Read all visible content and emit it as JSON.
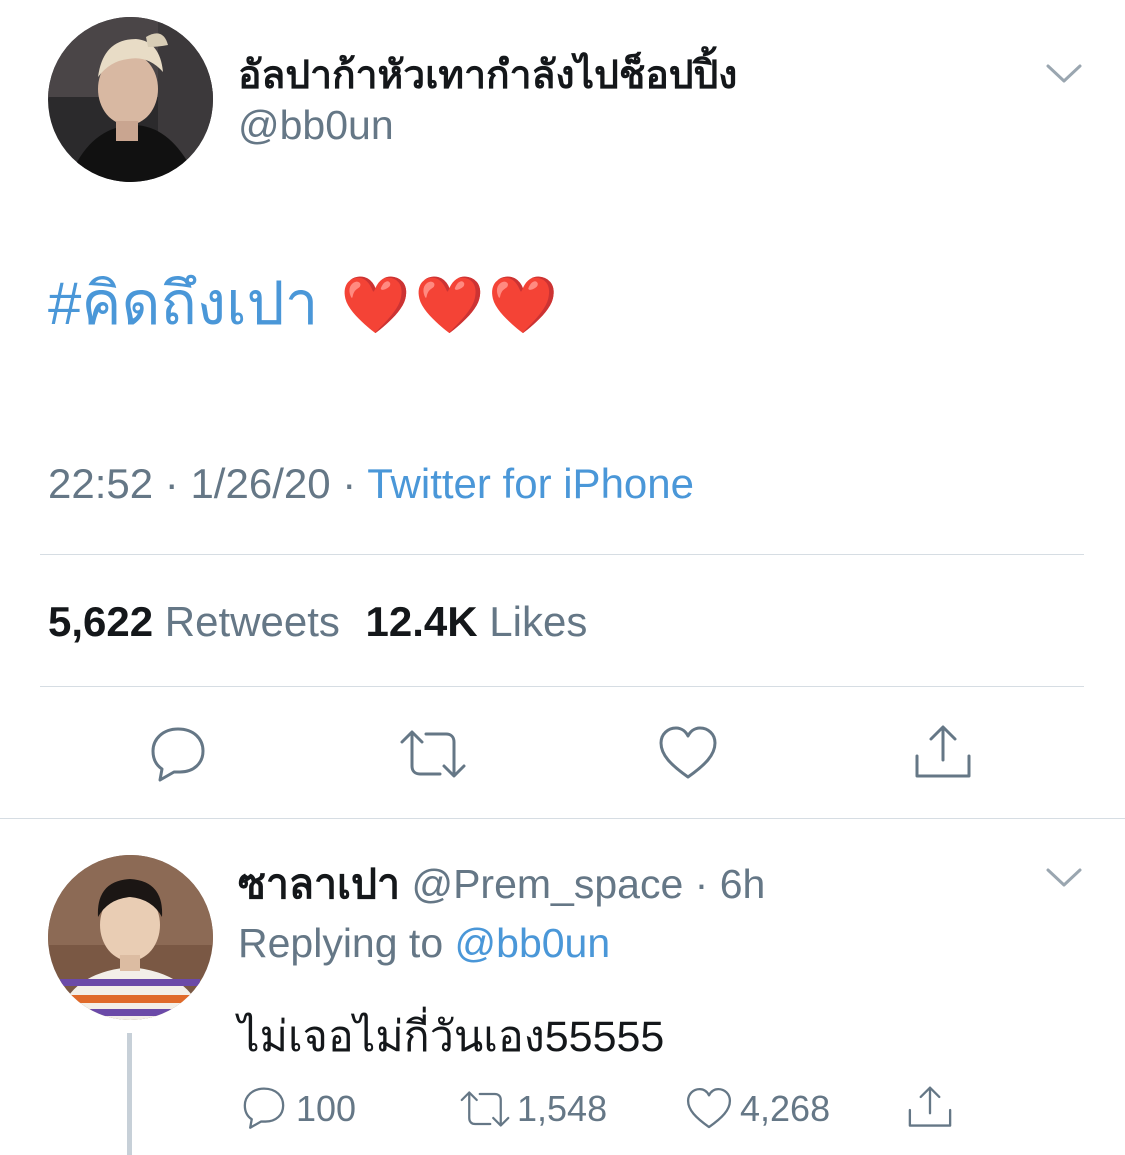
{
  "tweet": {
    "display_name": "อัลปาก้าหัวเทากำลังไปช็อปปิ้ง",
    "handle": "@bb0un",
    "hashtag": "#คิดถึงเปา",
    "hearts": "❤️❤️❤️",
    "time": "22:52",
    "date": "1/26/20",
    "separator": "·",
    "source": "Twitter for iPhone",
    "retweet_count": "5,622",
    "retweet_label": "Retweets",
    "like_count": "12.4K",
    "like_label": "Likes",
    "actions": [
      "reply-icon",
      "retweet-icon",
      "like-icon",
      "share-icon"
    ]
  },
  "reply": {
    "display_name": "ซาลาเปา",
    "handle": "@Prem_space",
    "separator": "·",
    "age": "6h",
    "replying_prefix": "Replying to",
    "replying_handle": "@bb0un",
    "text": "ไม่เจอไม่กี่วันเอง55555",
    "reply_count": "100",
    "retweet_count": "1,548",
    "like_count": "4,268"
  },
  "colors": {
    "accent": "#4a97d8",
    "muted": "#657786",
    "divider": "#d6dde3",
    "heart": "#e0202a"
  }
}
